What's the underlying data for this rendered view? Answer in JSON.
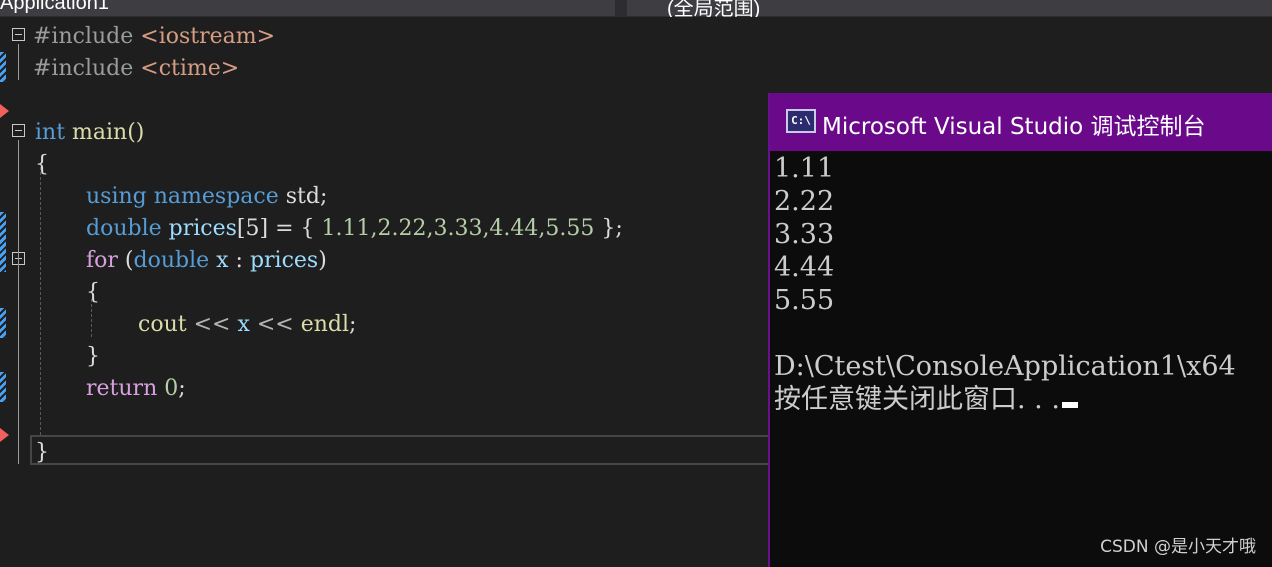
{
  "tabs": {
    "left_label": "Application1",
    "right_label": "(全局范围)"
  },
  "code": {
    "l1": {
      "a": "#include ",
      "b": "<iostream>"
    },
    "l2": {
      "a": "#include ",
      "b": "<ctime>"
    },
    "l4": {
      "kw": "int",
      "name": " main()"
    },
    "l5": {
      "text": "{"
    },
    "l6": {
      "kw1": "using",
      "kw2": "namespace",
      "rest": " std;"
    },
    "l7": {
      "kw": "double",
      "var": "prices",
      "rest": "[5] = { ",
      "nums": "1.11,2.22,3.33,4.44,5.55",
      "end": " };"
    },
    "l8": {
      "kw": "for",
      "p1": " (",
      "kw2": "double",
      "var": " x",
      "p2": " : ",
      "var2": "prices",
      "p3": ")"
    },
    "l9": {
      "text": "{"
    },
    "l10": {
      "a": "cout",
      "op1": " << ",
      "var": "x",
      "op2": " << ",
      "b": "endl",
      "end": ";"
    },
    "l11": {
      "text": "}"
    },
    "l12": {
      "kw": "return",
      "num": " 0",
      "end": ";"
    },
    "l14": {
      "text": "}"
    }
  },
  "console": {
    "title": "Microsoft Visual Studio 调试控制台",
    "icon_label": "C:\\",
    "lines": [
      "1.11",
      "2.22",
      "3.33",
      "4.44",
      "5.55"
    ],
    "path": "D:\\Ctest\\ConsoleApplication1\\x64",
    "prompt": "按任意键关闭此窗口. . ."
  },
  "watermark": "CSDN @是小天才哦",
  "colors": {
    "keyword": "#569cd6",
    "control": "#d8a0df",
    "titlebar": "#6a0a8a"
  }
}
